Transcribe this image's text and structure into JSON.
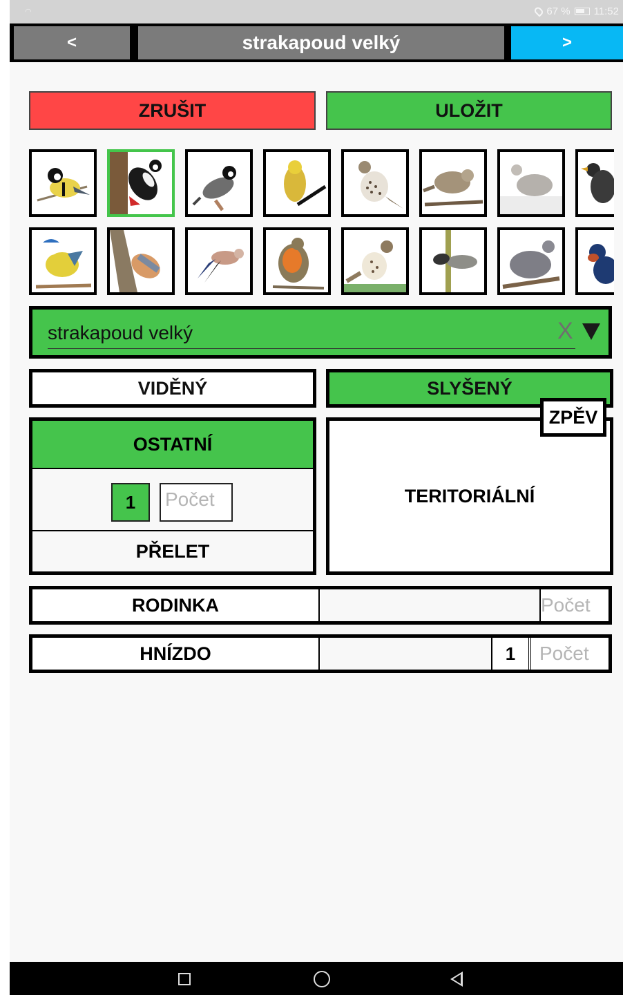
{
  "status_bar": {
    "battery": "67 %",
    "time": "11:52"
  },
  "header": {
    "prev_label": "<",
    "title": "strakapoud velký",
    "next_label": ">"
  },
  "actions": {
    "cancel_label": "ZRUŠIT",
    "save_label": "ULOŽIT"
  },
  "colors": {
    "accent_green": "#45c44c",
    "cancel_red": "#ff4646",
    "next_blue": "#08b8f4",
    "header_gray": "#7b7b7b"
  },
  "bird_grid": {
    "selected_index": 1,
    "birds": [
      "great-tit",
      "great-spotted-woodpecker",
      "coal-tit",
      "yellowhammer",
      "mistle-thrush",
      "common-whitethroat",
      "collared-dove",
      "black-redstart",
      "blue-tit",
      "nuthatch",
      "jay",
      "robin",
      "song-thrush",
      "blackcap",
      "wood-pigeon",
      "swallow"
    ]
  },
  "species_select": {
    "value": "strakapoud velký",
    "clear_label": "X"
  },
  "observation": {
    "seen_label": "VIDĚNÝ",
    "heard_label": "SLYŠENÝ",
    "other_label": "OSTATNÍ",
    "count_value": "1",
    "count_placeholder": "Počet",
    "flyover_label": "PŘELET",
    "territorial_label": "TERITORIÁLNÍ",
    "song_label": "ZPĚV"
  },
  "family_row": {
    "label": "RODINKA",
    "count_placeholder": "Počet"
  },
  "nest_row": {
    "label": "HNÍZDO",
    "count_value": "1",
    "count_placeholder": "Počet"
  }
}
